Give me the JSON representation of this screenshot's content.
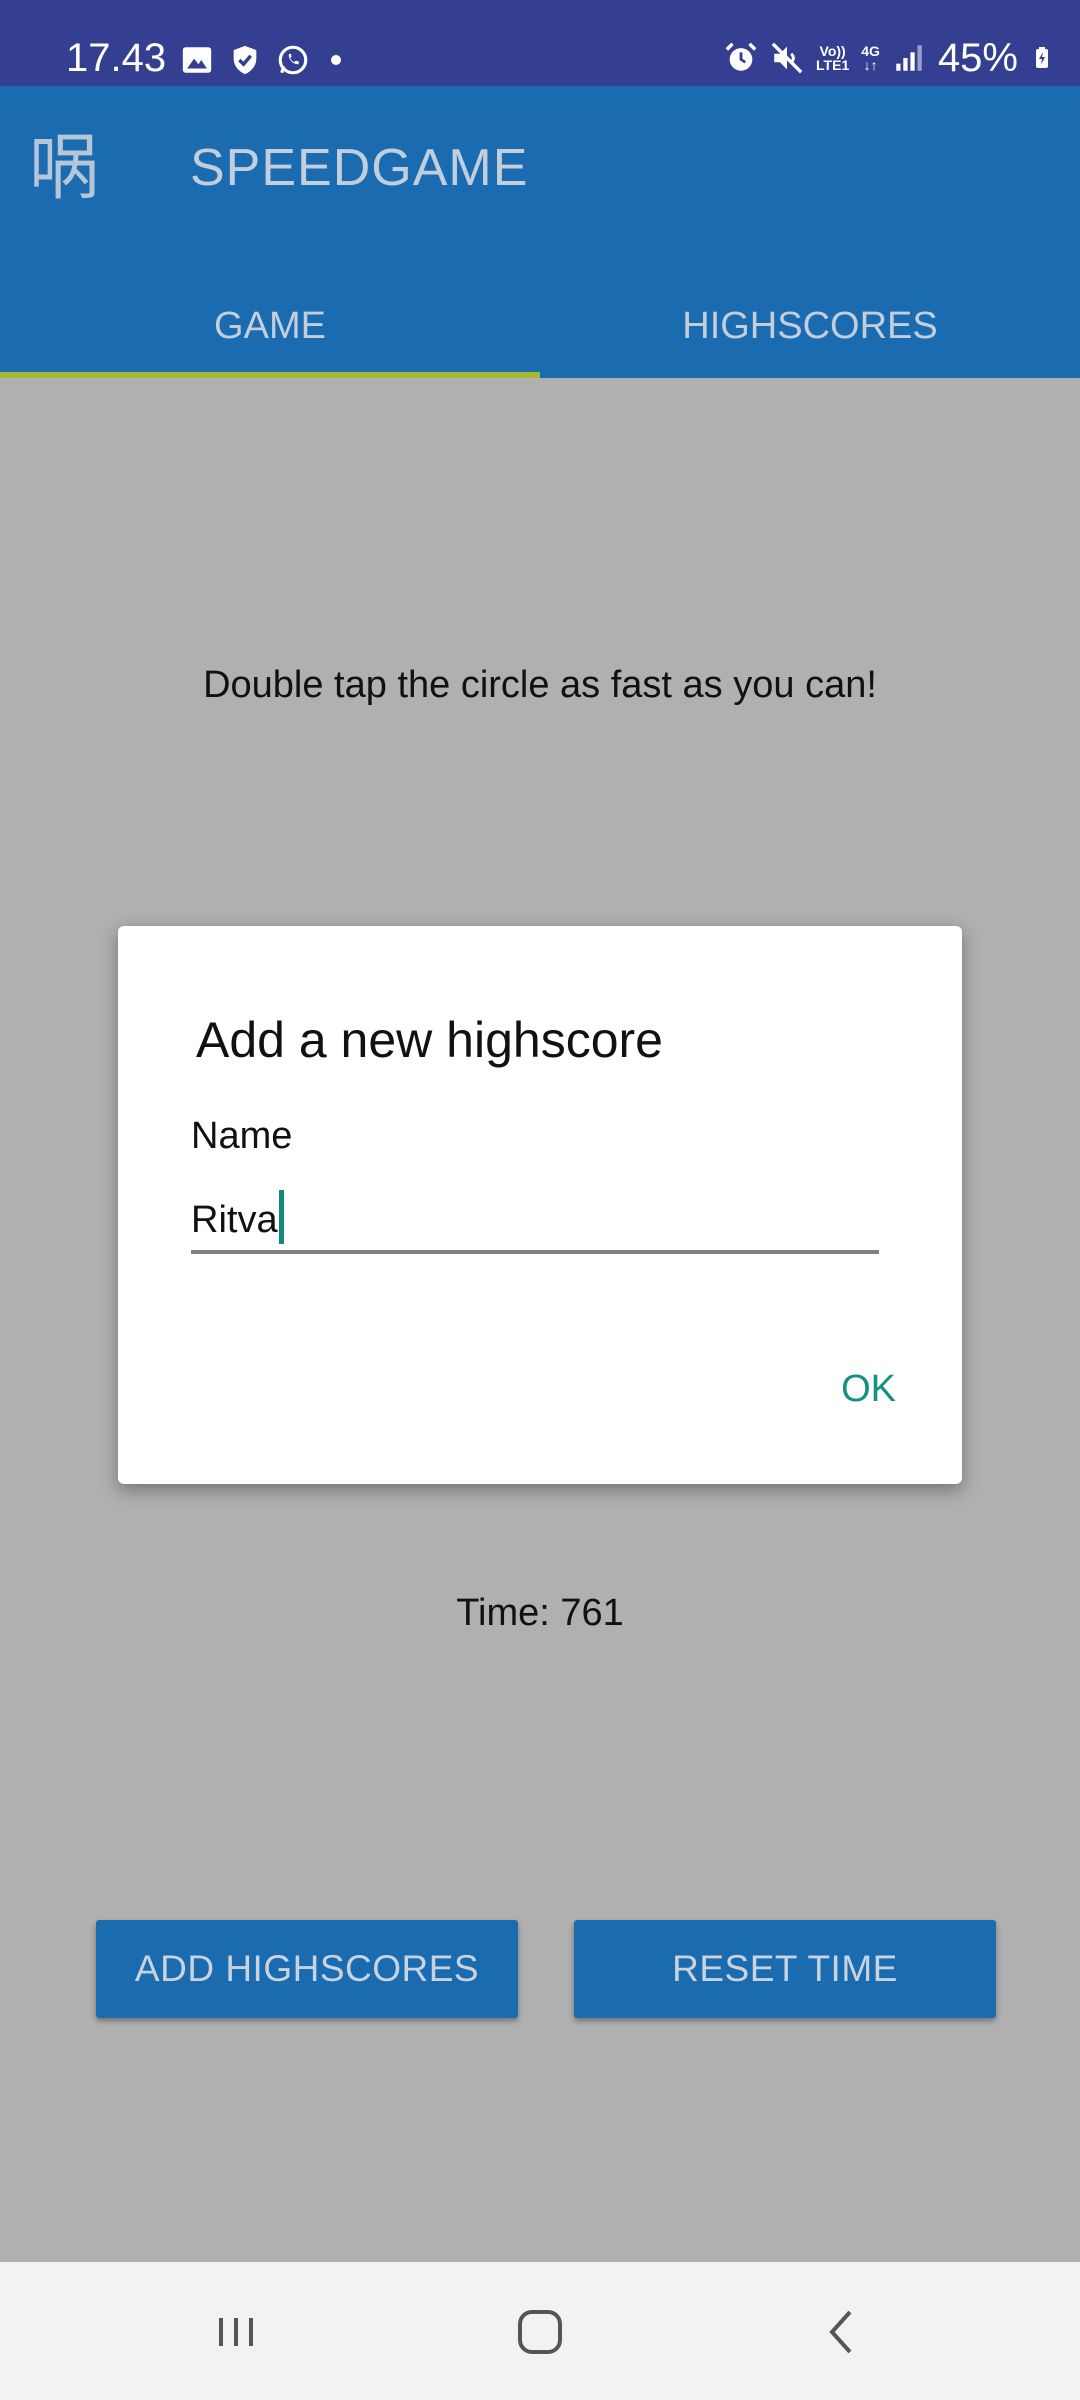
{
  "status_bar": {
    "time": "17.43",
    "battery": "45%",
    "icons_left": [
      "image-icon",
      "shield-icon",
      "whatsapp-icon",
      "dot-icon"
    ],
    "icons_right": [
      "alarm-icon",
      "mute-icon",
      "volte-icon",
      "4g-icon",
      "signal-icon",
      "battery-charging-icon"
    ],
    "volte_top": "Vo))",
    "volte_bottom": "LTE1",
    "net_top": "4G"
  },
  "app_bar": {
    "icon_glyph": "㖞",
    "title": "SPEEDGAME"
  },
  "tabs": [
    {
      "label": "GAME",
      "selected": true
    },
    {
      "label": "HIGHSCORES",
      "selected": false
    }
  ],
  "main": {
    "instruction": "Double tap the circle as fast as you can!",
    "time_text": "Time: 761",
    "add_button": "ADD HIGHSCORES",
    "reset_button": "RESET TIME"
  },
  "dialog": {
    "title": "Add a new highscore",
    "label": "Name",
    "input_value": "Ritva",
    "ok_label": "OK"
  },
  "colors": {
    "status_bar": "#353f92",
    "app_bar": "#1a6bb0",
    "tab_indicator": "#a7b832",
    "accent": "#139183",
    "scrim": "#b0b0b0"
  }
}
